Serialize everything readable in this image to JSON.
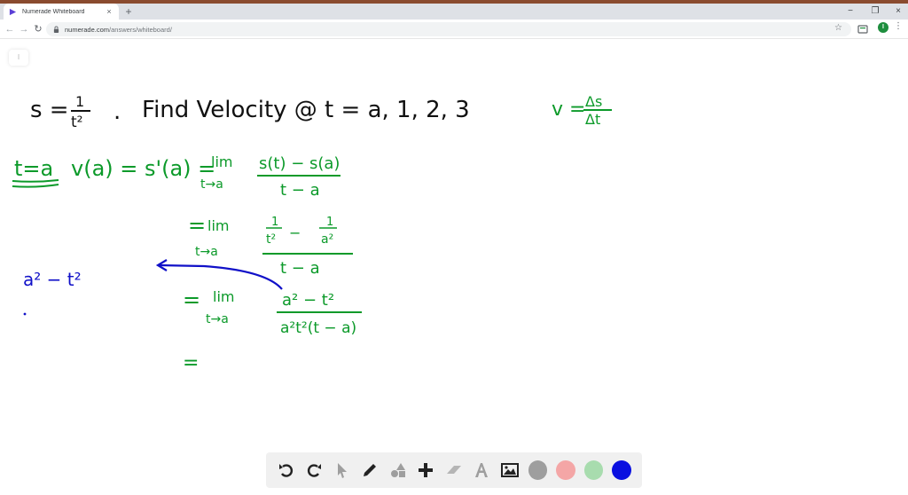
{
  "browser": {
    "tab_title": "Numerade Whiteboard",
    "tab_close": "×",
    "new_tab": "+",
    "url_domain": "numerade.com",
    "url_path": "/answers/whiteboard/",
    "profile_initial": "I",
    "window_controls": {
      "minimize": "−",
      "restore": "❐",
      "close": "×"
    },
    "nav": {
      "back": "←",
      "forward": "→",
      "reload": "↻"
    },
    "bookmark_star": "☆",
    "menu": "⋮"
  },
  "whiteboard": {
    "side_button": "⁝",
    "lines": [
      {
        "id": "problem",
        "color": "black",
        "text": "s = 1/t² . Find Velocity @ t = a, 1, 2, 3"
      },
      {
        "id": "formula",
        "color": "green",
        "text": "v = Δs/Δt"
      },
      {
        "id": "step1",
        "color": "green",
        "text": "t = a  v(a) = s'(a) = lim t→a  (s(t) − s(a)) / (t − a)"
      },
      {
        "id": "step2",
        "color": "green",
        "text": "= lim t→a  (1/t² − 1/a²) / (t − a)"
      },
      {
        "id": "step3",
        "color": "green",
        "text": "= lim t→a  (a² − t²) / (a²t²(t − a))"
      },
      {
        "id": "note",
        "color": "blue",
        "text": "a² − t²"
      },
      {
        "id": "step4",
        "color": "green",
        "text": "="
      }
    ]
  },
  "palette": {
    "tools": [
      {
        "name": "undo-tool",
        "glyph": "↶"
      },
      {
        "name": "redo-tool",
        "glyph": "↷"
      },
      {
        "name": "select-tool",
        "glyph": "➤"
      },
      {
        "name": "pen-tool",
        "glyph": "✎"
      },
      {
        "name": "shapes-tool",
        "glyph": "▲"
      },
      {
        "name": "add-tool",
        "glyph": "+"
      },
      {
        "name": "eraser-tool",
        "glyph": "▱"
      },
      {
        "name": "text-tool",
        "glyph": "A"
      },
      {
        "name": "image-tool",
        "glyph": "🖼"
      }
    ],
    "colors": {
      "gray": "#9e9e9e",
      "pink": "#f4a6a6",
      "green": "#a8dcae",
      "blue": "#0a10e0"
    }
  }
}
